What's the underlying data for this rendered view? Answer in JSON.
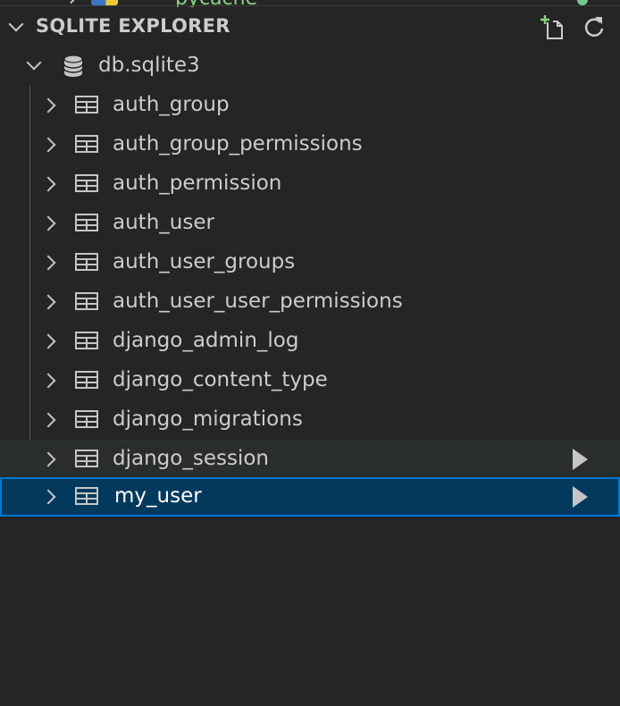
{
  "previous_row": {
    "label": "__pycache__",
    "icon": "python-folder-icon",
    "status_color": "#73c991"
  },
  "panel": {
    "title": "SQLITE EXPLORER",
    "actions": [
      {
        "name": "new-query",
        "icon": "add-file-icon"
      },
      {
        "name": "refresh",
        "icon": "refresh-icon"
      }
    ]
  },
  "database": {
    "name": "db.sqlite3",
    "icon": "database-icon",
    "expanded": true
  },
  "tables": [
    {
      "name": "auth_group",
      "icon": "table-icon",
      "state": "normal"
    },
    {
      "name": "auth_group_permissions",
      "icon": "table-icon",
      "state": "normal"
    },
    {
      "name": "auth_permission",
      "icon": "table-icon",
      "state": "normal"
    },
    {
      "name": "auth_user",
      "icon": "table-icon",
      "state": "normal"
    },
    {
      "name": "auth_user_groups",
      "icon": "table-icon",
      "state": "normal"
    },
    {
      "name": "auth_user_user_permissions",
      "icon": "table-icon",
      "state": "normal"
    },
    {
      "name": "django_admin_log",
      "icon": "table-icon",
      "state": "normal"
    },
    {
      "name": "django_content_type",
      "icon": "table-icon",
      "state": "normal"
    },
    {
      "name": "django_migrations",
      "icon": "table-icon",
      "state": "normal"
    },
    {
      "name": "django_session",
      "icon": "table-icon",
      "state": "hover"
    },
    {
      "name": "my_user",
      "icon": "table-icon",
      "state": "selected"
    }
  ],
  "colors": {
    "background": "#252526",
    "hover": "#2a2d2e",
    "selected_bg": "#04395e",
    "selected_border": "#0078d4",
    "add_accent": "#89d185"
  }
}
